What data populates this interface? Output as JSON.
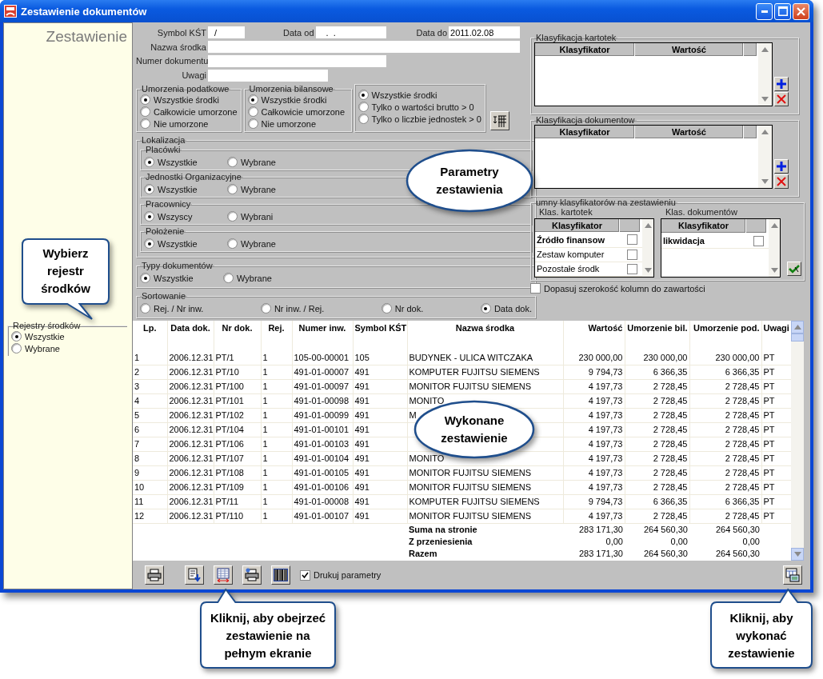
{
  "window": {
    "title": "Zestawienie dokumentów"
  },
  "sidebar": {
    "heading": "Zestawienie",
    "registers": {
      "legend": "Rejestry środków",
      "options": [
        {
          "label": "Wszystkie",
          "selected": true
        },
        {
          "label": "Wybrane",
          "selected": false
        }
      ]
    }
  },
  "fields": [
    {
      "label": "Symbol KŚT",
      "value": "/"
    },
    {
      "label": "Data od",
      "value": " .  ."
    },
    {
      "label": "Data do",
      "value": "2011.02.08"
    },
    {
      "label": "Nazwa środka"
    },
    {
      "label": "Numer dokumentu"
    },
    {
      "label": "Uwagi"
    }
  ],
  "depreciation_groups": [
    {
      "legend": "Umorzenia podatkowe",
      "options": [
        {
          "label": "Wszystkie środki",
          "selected": true
        },
        {
          "label": "Całkowicie umorzone",
          "selected": false
        },
        {
          "label": "Nie umorzone",
          "selected": false
        }
      ]
    },
    {
      "legend": "Umorzenia bilansowe",
      "options": [
        {
          "label": "Wszystkie środki",
          "selected": true
        },
        {
          "label": "Całkowicie umorzone",
          "selected": false
        },
        {
          "label": "Nie umorzone",
          "selected": false
        }
      ]
    },
    {
      "options": [
        {
          "label": "Wszystkie środki",
          "selected": true
        },
        {
          "label": "Tylko o wartości brutto > 0",
          "selected": false
        },
        {
          "label": "Tylko o liczbie jednostek > 0",
          "selected": false
        }
      ]
    }
  ],
  "location": {
    "legend": "Lokalizacja",
    "groups": [
      {
        "legend": "Placówki",
        "options": [
          {
            "label": "Wszystkie",
            "selected": true
          },
          {
            "label": "Wybrane",
            "selected": false
          }
        ]
      },
      {
        "legend": "Jednostki Organizacyjne",
        "options": [
          {
            "label": "Wszystkie",
            "selected": true
          },
          {
            "label": "Wybrane",
            "selected": false
          }
        ]
      },
      {
        "legend": "Pracownicy",
        "options": [
          {
            "label": "Wszyscy",
            "selected": true
          },
          {
            "label": "Wybrani",
            "selected": false
          }
        ]
      },
      {
        "legend": "Położenie",
        "options": [
          {
            "label": "Wszystkie",
            "selected": true
          },
          {
            "label": "Wybrane",
            "selected": false
          }
        ]
      }
    ]
  },
  "document_types": {
    "legend": "Typy dokumentów",
    "options": [
      {
        "label": "Wszystkie",
        "selected": true
      },
      {
        "label": "Wybrane",
        "selected": false
      }
    ]
  },
  "sorting": {
    "legend": "Sortowanie",
    "options": [
      {
        "label": "Rej. / Nr inw.",
        "selected": false
      },
      {
        "label": "Nr inw. / Rej.",
        "selected": false
      },
      {
        "label": "Nr dok.",
        "selected": false
      },
      {
        "label": "Data dok.",
        "selected": true
      }
    ]
  },
  "classifications": [
    {
      "legend": "Klasyfikacja kartotek",
      "columns": [
        "Klasyfikator",
        "Wartość"
      ]
    },
    {
      "legend": "Klasyfikacja dokumentow",
      "columns": [
        "Klasyfikator",
        "Wartość"
      ]
    }
  ],
  "classifier_columns": {
    "legend": "umny klasyfikatorów na zestawieniu",
    "lists": [
      {
        "label": "Klas. kartotek",
        "column": "Klasyfikator",
        "items": [
          {
            "label": "Źródło finansow",
            "selected": true,
            "checked": false
          },
          {
            "label": "Zestaw komputer",
            "selected": false,
            "checked": false
          },
          {
            "label": "Pozostałe środk",
            "selected": false,
            "checked": false
          }
        ]
      },
      {
        "label": "Klas. dokumentów",
        "column": "Klasyfikator",
        "items": [
          {
            "label": "likwidacja",
            "selected": true,
            "checked": false
          }
        ]
      }
    ]
  },
  "fit_columns": {
    "label": "Dopasuj szerokość kolumn do zawartości",
    "checked": false
  },
  "table": {
    "columns": [
      "Lp.",
      "Data dok.",
      "Nr dok.",
      "Rej.",
      "Numer inw.",
      "Symbol KŚT",
      "Nazwa środka",
      "Wartość",
      "Umorzenie bil.",
      "Umorzenie pod.",
      "Uwagi"
    ],
    "rows": [
      {
        "lp": "1",
        "date": "2006.12.31",
        "doc": "PT/1",
        "reg": "1",
        "inv": "105-00-00001",
        "kst": "105",
        "name": "BUDYNEK - ULICA WITCZAKA",
        "value": "230 000,00",
        "dep_bal": "230 000,00",
        "dep_tax": "230 000,00",
        "notes": "PT"
      },
      {
        "lp": "2",
        "date": "2006.12.31",
        "doc": "PT/10",
        "reg": "1",
        "inv": "491-01-00007",
        "kst": "491",
        "name": "KOMPUTER FUJITSU SIEMENS",
        "value": "9 794,73",
        "dep_bal": "6 366,35",
        "dep_tax": "6 366,35",
        "notes": "PT"
      },
      {
        "lp": "3",
        "date": "2006.12.31",
        "doc": "PT/100",
        "reg": "1",
        "inv": "491-01-00097",
        "kst": "491",
        "name": "MONITOR FUJITSU SIEMENS",
        "value": "4 197,73",
        "dep_bal": "2 728,45",
        "dep_tax": "2 728,45",
        "notes": "PT"
      },
      {
        "lp": "4",
        "date": "2006.12.31",
        "doc": "PT/101",
        "reg": "1",
        "inv": "491-01-00098",
        "kst": "491",
        "name": "MONITO",
        "value": "4 197,73",
        "dep_bal": "2 728,45",
        "dep_tax": "2 728,45",
        "notes": "PT"
      },
      {
        "lp": "5",
        "date": "2006.12.31",
        "doc": "PT/102",
        "reg": "1",
        "inv": "491-01-00099",
        "kst": "491",
        "name": "M",
        "value": "4 197,73",
        "dep_bal": "2 728,45",
        "dep_tax": "2 728,45",
        "notes": "PT"
      },
      {
        "lp": "6",
        "date": "2006.12.31",
        "doc": "PT/104",
        "reg": "1",
        "inv": "491-01-00101",
        "kst": "491",
        "value": "4 197,73",
        "dep_bal": "2 728,45",
        "dep_tax": "2 728,45",
        "notes": "PT"
      },
      {
        "lp": "7",
        "date": "2006.12.31",
        "doc": "PT/106",
        "reg": "1",
        "inv": "491-01-00103",
        "kst": "491",
        "value": "4 197,73",
        "dep_bal": "2 728,45",
        "dep_tax": "2 728,45",
        "notes": "PT"
      },
      {
        "lp": "8",
        "date": "2006.12.31",
        "doc": "PT/107",
        "reg": "1",
        "inv": "491-01-00104",
        "kst": "491",
        "name": "MONITO",
        "value": "4 197,73",
        "dep_bal": "2 728,45",
        "dep_tax": "2 728,45",
        "notes": "PT"
      },
      {
        "lp": "9",
        "date": "2006.12.31",
        "doc": "PT/108",
        "reg": "1",
        "inv": "491-01-00105",
        "kst": "491",
        "name": "MONITOR FUJITSU SIEMENS",
        "value": "4 197,73",
        "dep_bal": "2 728,45",
        "dep_tax": "2 728,45",
        "notes": "PT"
      },
      {
        "lp": "10",
        "date": "2006.12.31",
        "doc": "PT/109",
        "reg": "1",
        "inv": "491-01-00106",
        "kst": "491",
        "name": "MONITOR FUJITSU SIEMENS",
        "value": "4 197,73",
        "dep_bal": "2 728,45",
        "dep_tax": "2 728,45",
        "notes": "PT"
      },
      {
        "lp": "11",
        "date": "2006.12.31",
        "doc": "PT/11",
        "reg": "1",
        "inv": "491-01-00008",
        "kst": "491",
        "name": "KOMPUTER FUJITSU SIEMENS",
        "value": "9 794,73",
        "dep_bal": "6 366,35",
        "dep_tax": "6 366,35",
        "notes": "PT"
      },
      {
        "lp": "12",
        "date": "2006.12.31",
        "doc": "PT/110",
        "reg": "1",
        "inv": "491-01-00107",
        "kst": "491",
        "name": "MONITOR FUJITSU SIEMENS",
        "value": "4 197,73",
        "dep_bal": "2 728,45",
        "dep_tax": "2 728,45",
        "notes": "PT"
      }
    ],
    "totals": [
      {
        "label": "Suma na stronie",
        "values": [
          "283 171,30",
          "264 560,30",
          "264 560,30"
        ]
      },
      {
        "label": "Z przeniesienia",
        "values": [
          "0,00",
          "0,00",
          "0,00"
        ]
      },
      {
        "label": "Razem",
        "values": [
          "283 171,30",
          "264 560,30",
          "264 560,30"
        ]
      }
    ]
  },
  "toolbar": {
    "print_params": {
      "label": "Drukuj parametry",
      "checked": true
    }
  },
  "callouts": [
    {
      "kind": "box-down",
      "text": "Wybierz rejestr środków"
    },
    {
      "kind": "ellipse",
      "text": "Parametry zestawienia"
    },
    {
      "kind": "ellipse",
      "text": "Wykonane zestawienie"
    },
    {
      "kind": "box-up",
      "text": "Kliknij, aby obejrzeć zestawienie na pełnym ekranie"
    },
    {
      "kind": "box-up",
      "text": "Kliknij, aby wykonać zestawienie"
    }
  ]
}
